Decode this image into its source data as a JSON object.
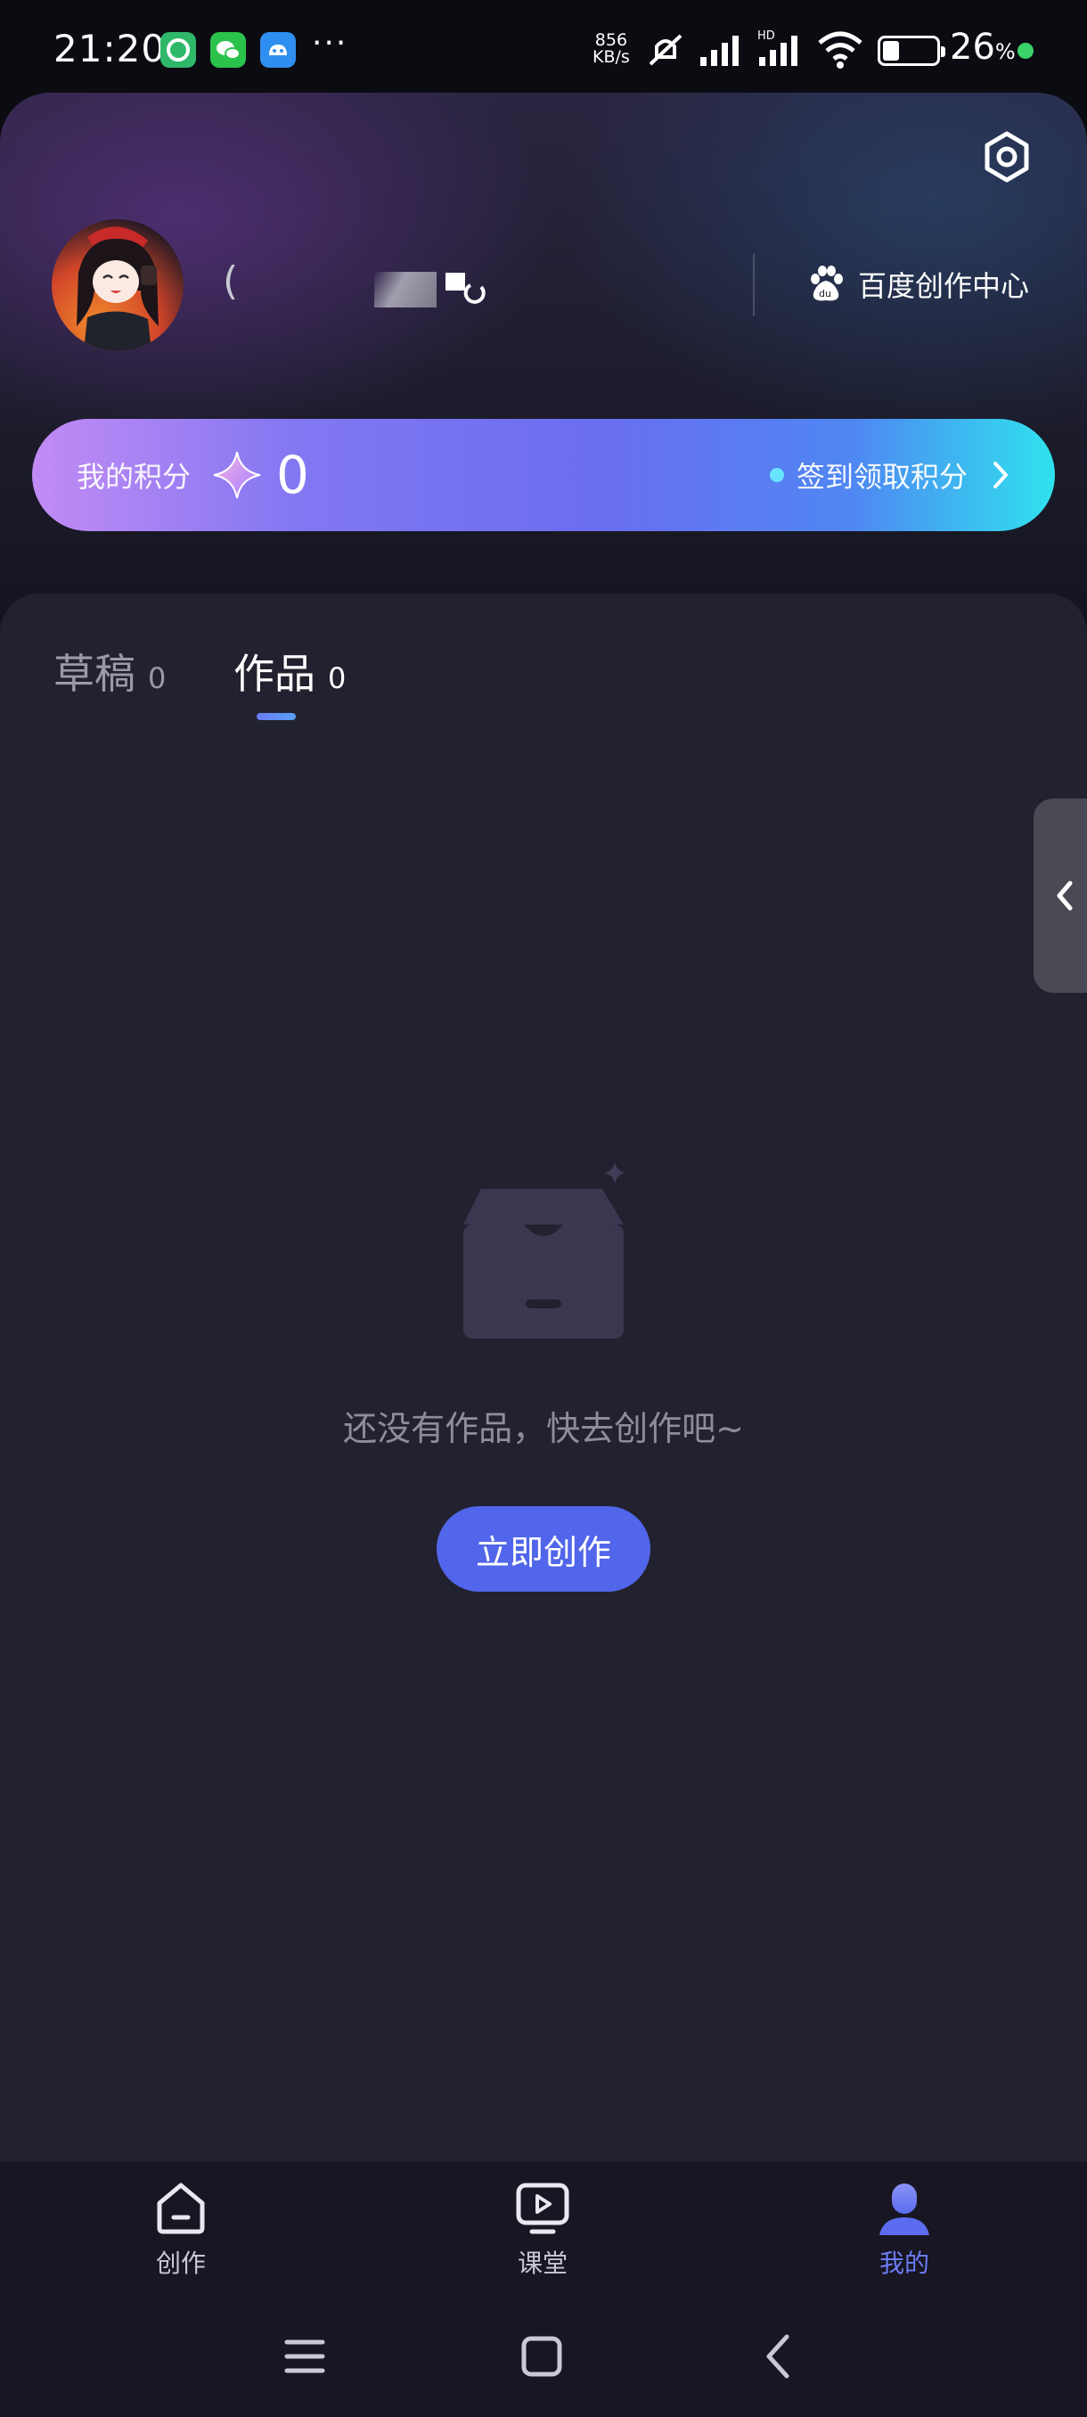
{
  "status_bar": {
    "time": "21:20",
    "net_speed_value": "856",
    "net_speed_unit": "KB/s",
    "battery_percent": "26",
    "battery_unit": "%",
    "app_icons": [
      "app-green-icon",
      "wechat-icon",
      "android-app-icon"
    ],
    "more": "···",
    "colors": {
      "charging_dot": "#3ad36a"
    }
  },
  "header": {
    "username_visible": "(",
    "creator_center_label": "百度创作中心",
    "points": {
      "label": "我的积分",
      "value": "0",
      "checkin_label": "签到领取积分"
    }
  },
  "tabs": [
    {
      "label": "草稿",
      "count": "0",
      "active": false
    },
    {
      "label": "作品",
      "count": "0",
      "active": true
    }
  ],
  "empty_state": {
    "message": "还没有作品，快去创作吧~",
    "button_label": "立即创作"
  },
  "bottom_nav": [
    {
      "label": "创作",
      "icon": "home-icon",
      "active": false
    },
    {
      "label": "课堂",
      "icon": "play-screen-icon",
      "active": false
    },
    {
      "label": "我的",
      "icon": "profile-icon",
      "active": true
    }
  ],
  "colors": {
    "accent": "#5166ea",
    "active_nav": "#6b7cf4",
    "panel_bg": "#22212f"
  }
}
